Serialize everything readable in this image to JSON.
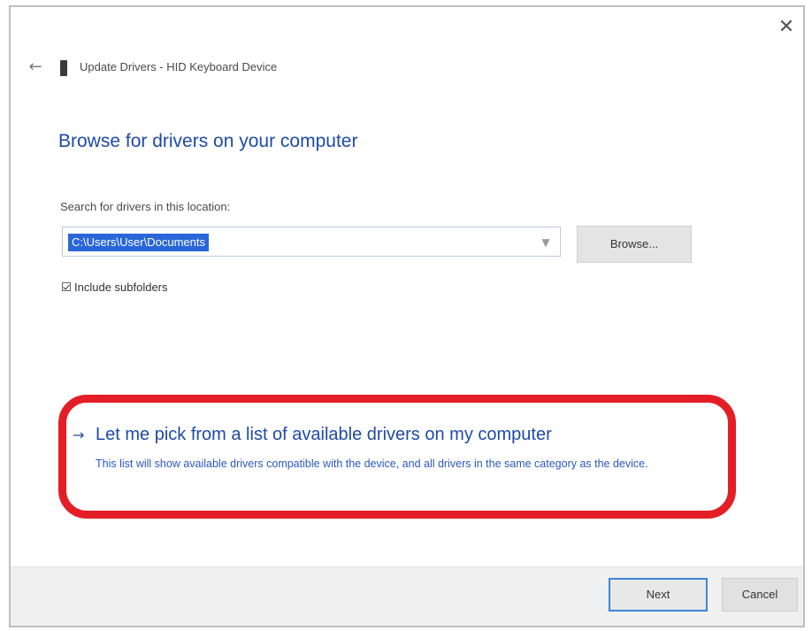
{
  "window": {
    "title": "Update Drivers - HID Keyboard Device",
    "close_glyph": "✕",
    "back_glyph": "←"
  },
  "main": {
    "heading": "Browse for drivers on your computer",
    "search_label": "Search for drivers in this location:",
    "path_value": "C:\\Users\\User\\Documents",
    "browse_label": "Browse...",
    "include_subfolders_label": "Include subfolders",
    "include_subfolders_checked": true
  },
  "pick_option": {
    "arrow_glyph": "→",
    "title": "Let me pick from a list of available drivers on my computer",
    "description": "This list will show available drivers compatible with the device, and all drivers in the same category as the device.",
    "highlight_color": "#e31e26"
  },
  "footer": {
    "next_label": "Next",
    "cancel_label": "Cancel"
  },
  "icons": {
    "close": "close-icon",
    "back": "back-arrow-icon",
    "device": "keyboard-device-icon",
    "dropdown": "chevron-down-icon",
    "option_arrow": "arrow-right-icon"
  }
}
